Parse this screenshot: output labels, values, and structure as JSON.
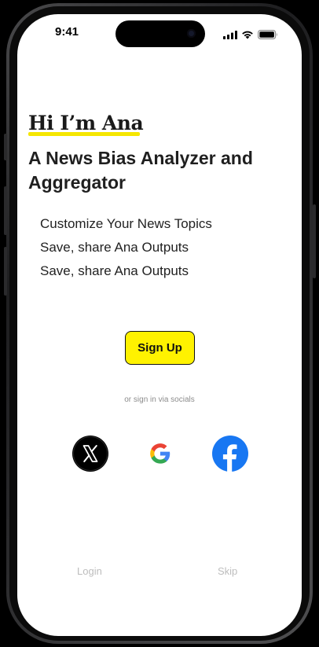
{
  "status_bar": {
    "time": "9:41"
  },
  "hero": {
    "greeting": "Hi I’m Ana",
    "headline": "A News Bias Analyzer and Aggregator"
  },
  "features": [
    "Customize Your News Topics",
    "Save, share Ana Outputs",
    "Save, share Ana Outputs"
  ],
  "actions": {
    "signup_label": "Sign Up",
    "social_prompt": "or sign in via socials",
    "login_label": "Login",
    "skip_label": "Skip"
  },
  "socials": [
    {
      "icon": "x-logo-icon"
    },
    {
      "icon": "google-logo-icon"
    },
    {
      "icon": "facebook-logo-icon"
    }
  ],
  "colors": {
    "accent_yellow": "#fff200",
    "underline_yellow": "#f5e600",
    "facebook_blue": "#1877f2",
    "muted_text": "#bdbdbd"
  }
}
